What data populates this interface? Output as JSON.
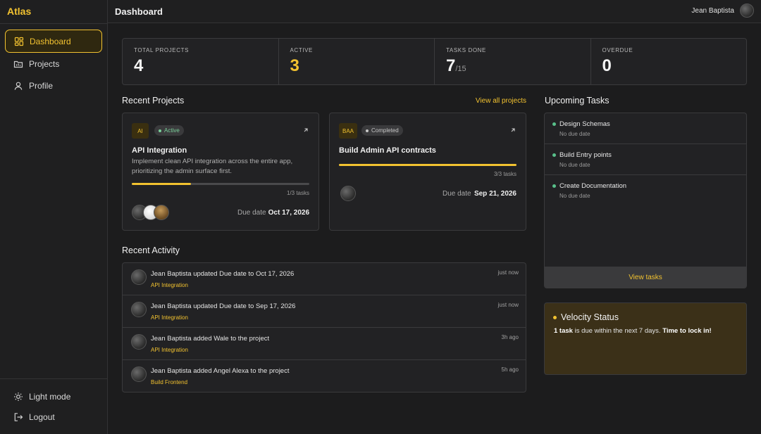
{
  "app": {
    "brand": "Atlas",
    "page_title": "Dashboard",
    "user_name": "Jean Baptista",
    "accent": "#f2c230"
  },
  "sidebar": {
    "items": [
      {
        "label": "Dashboard",
        "icon": "grid-icon",
        "active": true
      },
      {
        "label": "Projects",
        "icon": "folder-icon"
      },
      {
        "label": "Profile",
        "icon": "user-icon"
      }
    ],
    "bottom": [
      {
        "label": "Light mode",
        "icon": "sun-icon"
      },
      {
        "label": "Logout",
        "icon": "logout-icon"
      }
    ]
  },
  "stats": [
    {
      "label": "TOTAL PROJECTS",
      "value": "4"
    },
    {
      "label": "ACTIVE",
      "value": "3"
    },
    {
      "label": "TASKS DONE",
      "value": "7",
      "sub": "/15"
    },
    {
      "label": "OVERDUE",
      "value": "0"
    }
  ],
  "recent_projects": {
    "title": "Recent Projects",
    "view_all": "View all projects",
    "items": [
      {
        "badge": "AI",
        "status": "Active",
        "name": "API Integration",
        "description": "Implement clean API integration across the entire app, prioritizing the admin surface first.",
        "progress": 0.333,
        "tasks": "1/3 tasks",
        "due_label": "Due date",
        "due": "Oct 17, 2026"
      },
      {
        "badge": "BAA",
        "status": "Completed",
        "name": "Build Admin API contracts",
        "progress": 1.0,
        "tasks": "3/3 tasks",
        "due_label": "Due date",
        "due": "Sep 21, 2026"
      }
    ]
  },
  "recent_activity": {
    "title": "Recent Activity",
    "items": [
      {
        "text": "Jean Baptista updated Due date to Oct 17, 2026",
        "project": "API Integration",
        "time": "just now"
      },
      {
        "text": "Jean Baptista updated Due date to Sep 17, 2026",
        "project": "API Integration",
        "time": "just now"
      },
      {
        "text": "Jean Baptista added Wale to the project",
        "project": "API Integration",
        "time": "3h ago"
      },
      {
        "text": "Jean Baptista added Angel Alexa to the project",
        "project": "Build Frontend",
        "time": "5h ago"
      }
    ]
  },
  "upcoming_tasks": {
    "title": "Upcoming Tasks",
    "items": [
      {
        "name": "Design Schemas",
        "due": "No due date"
      },
      {
        "name": "Build Entry points",
        "due": "No due date"
      },
      {
        "name": "Create Documentation",
        "due": "No due date"
      }
    ],
    "footer": "View tasks"
  },
  "velocity": {
    "title": "Velocity Status",
    "count": "1 task",
    "middle": " is due within the next 7 days. ",
    "cta": "Time to lock in!"
  }
}
